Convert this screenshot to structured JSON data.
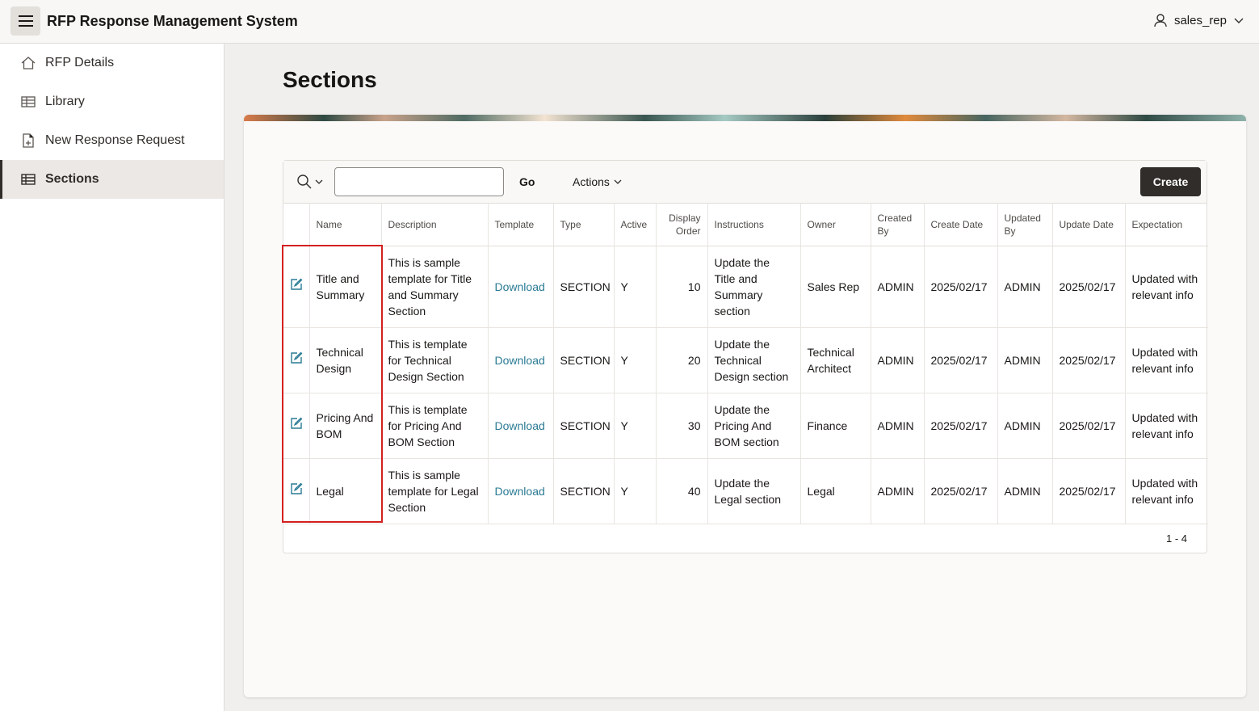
{
  "header": {
    "app_title": "RFP Response Management System",
    "menu_icon": "hamburger-icon",
    "user_name": "sales_rep"
  },
  "sidebar": {
    "items": [
      {
        "label": "RFP Details",
        "icon": "home-icon"
      },
      {
        "label": "Library",
        "icon": "grid-icon"
      },
      {
        "label": "New Response Request",
        "icon": "file-add-icon"
      },
      {
        "label": "Sections",
        "icon": "table-icon",
        "active": true
      }
    ]
  },
  "page": {
    "title": "Sections"
  },
  "toolbar": {
    "search_value": "",
    "go_label": "Go",
    "actions_label": "Actions",
    "create_label": "Create"
  },
  "table": {
    "columns": [
      "Name",
      "Description",
      "Template",
      "Type",
      "Active",
      "Display Order",
      "Instructions",
      "Owner",
      "Created By",
      "Create Date",
      "Updated By",
      "Update Date",
      "Expectation"
    ],
    "rows": [
      {
        "name": "Title and Summary",
        "description": "This is sample template for Title and Summary Section",
        "template": "Download",
        "type": "SECTION",
        "active": "Y",
        "display_order": "10",
        "instructions": "Update the Title and Summary section",
        "owner": "Sales Rep",
        "created_by": "ADMIN",
        "create_date": "2025/02/17",
        "updated_by": "ADMIN",
        "update_date": "2025/02/17",
        "expectation": "Updated with relevant info"
      },
      {
        "name": "Technical Design",
        "description": "This is template for Technical Design Section",
        "template": "Download",
        "type": "SECTION",
        "active": "Y",
        "display_order": "20",
        "instructions": "Update the Technical Design section",
        "owner": "Technical Architect",
        "created_by": "ADMIN",
        "create_date": "2025/02/17",
        "updated_by": "ADMIN",
        "update_date": "2025/02/17",
        "expectation": "Updated with relevant info"
      },
      {
        "name": "Pricing And BOM",
        "description": "This is template for Pricing And BOM Section",
        "template": "Download",
        "type": "SECTION",
        "active": "Y",
        "display_order": "30",
        "instructions": "Update the Pricing And BOM section",
        "owner": "Finance",
        "created_by": "ADMIN",
        "create_date": "2025/02/17",
        "updated_by": "ADMIN",
        "update_date": "2025/02/17",
        "expectation": "Updated with relevant info"
      },
      {
        "name": "Legal",
        "description": "This is sample template for Legal Section",
        "template": "Download",
        "type": "SECTION",
        "active": "Y",
        "display_order": "40",
        "instructions": "Update the Legal section",
        "owner": "Legal",
        "created_by": "ADMIN",
        "create_date": "2025/02/17",
        "updated_by": "ADMIN",
        "update_date": "2025/02/17",
        "expectation": "Updated with relevant info"
      }
    ],
    "pagination": "1 - 4"
  },
  "colors": {
    "accent_dark": "#312d2a",
    "link": "#2a7a94",
    "highlight": "#d32020"
  }
}
